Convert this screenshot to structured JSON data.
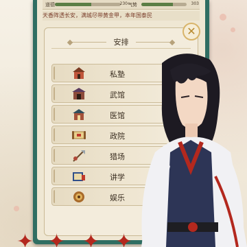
{
  "stats": [
    {
      "label": "道德",
      "value": "230",
      "level": 0.55
    },
    {
      "label": "气势",
      "value": "303",
      "level": 0.7
    }
  ],
  "news_ticker": "天香阵透长安，满城尽带黄金甲，本年国泰民",
  "dialog": {
    "title": "安排",
    "close_symbol": "✕"
  },
  "menu_items": [
    {
      "label": "私塾",
      "icon": "school-building-icon"
    },
    {
      "label": "武馆",
      "icon": "martial-hall-icon"
    },
    {
      "label": "医馆",
      "icon": "clinic-icon"
    },
    {
      "label": "政院",
      "icon": "scroll-icon"
    },
    {
      "label": "猎场",
      "icon": "hunting-weapon-icon"
    },
    {
      "label": "讲学",
      "icon": "lecture-book-icon"
    },
    {
      "label": "娱乐",
      "icon": "entertainment-icon"
    }
  ],
  "colors": {
    "panel_frame": "#2f6e62",
    "parchment": "#efe7d3",
    "accent_red": "#b3281e",
    "gold": "#d8b46a"
  }
}
